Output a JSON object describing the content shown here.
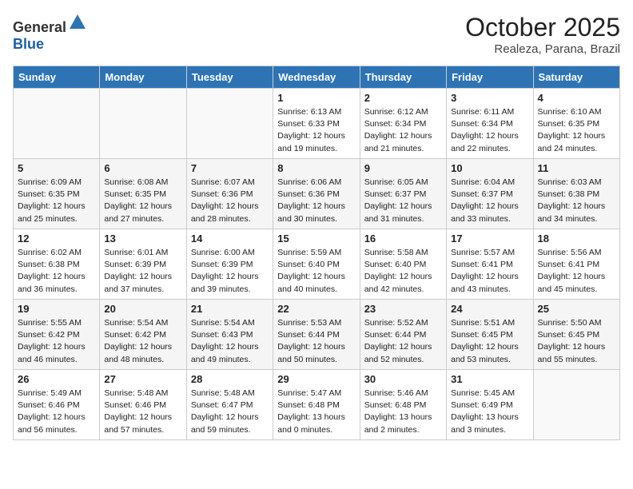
{
  "header": {
    "logo_general": "General",
    "logo_blue": "Blue",
    "month_year": "October 2025",
    "location": "Realeza, Parana, Brazil"
  },
  "weekdays": [
    "Sunday",
    "Monday",
    "Tuesday",
    "Wednesday",
    "Thursday",
    "Friday",
    "Saturday"
  ],
  "weeks": [
    [
      {
        "day": "",
        "info": ""
      },
      {
        "day": "",
        "info": ""
      },
      {
        "day": "",
        "info": ""
      },
      {
        "day": "1",
        "info": "Sunrise: 6:13 AM\nSunset: 6:33 PM\nDaylight: 12 hours\nand 19 minutes."
      },
      {
        "day": "2",
        "info": "Sunrise: 6:12 AM\nSunset: 6:34 PM\nDaylight: 12 hours\nand 21 minutes."
      },
      {
        "day": "3",
        "info": "Sunrise: 6:11 AM\nSunset: 6:34 PM\nDaylight: 12 hours\nand 22 minutes."
      },
      {
        "day": "4",
        "info": "Sunrise: 6:10 AM\nSunset: 6:35 PM\nDaylight: 12 hours\nand 24 minutes."
      }
    ],
    [
      {
        "day": "5",
        "info": "Sunrise: 6:09 AM\nSunset: 6:35 PM\nDaylight: 12 hours\nand 25 minutes."
      },
      {
        "day": "6",
        "info": "Sunrise: 6:08 AM\nSunset: 6:35 PM\nDaylight: 12 hours\nand 27 minutes."
      },
      {
        "day": "7",
        "info": "Sunrise: 6:07 AM\nSunset: 6:36 PM\nDaylight: 12 hours\nand 28 minutes."
      },
      {
        "day": "8",
        "info": "Sunrise: 6:06 AM\nSunset: 6:36 PM\nDaylight: 12 hours\nand 30 minutes."
      },
      {
        "day": "9",
        "info": "Sunrise: 6:05 AM\nSunset: 6:37 PM\nDaylight: 12 hours\nand 31 minutes."
      },
      {
        "day": "10",
        "info": "Sunrise: 6:04 AM\nSunset: 6:37 PM\nDaylight: 12 hours\nand 33 minutes."
      },
      {
        "day": "11",
        "info": "Sunrise: 6:03 AM\nSunset: 6:38 PM\nDaylight: 12 hours\nand 34 minutes."
      }
    ],
    [
      {
        "day": "12",
        "info": "Sunrise: 6:02 AM\nSunset: 6:38 PM\nDaylight: 12 hours\nand 36 minutes."
      },
      {
        "day": "13",
        "info": "Sunrise: 6:01 AM\nSunset: 6:39 PM\nDaylight: 12 hours\nand 37 minutes."
      },
      {
        "day": "14",
        "info": "Sunrise: 6:00 AM\nSunset: 6:39 PM\nDaylight: 12 hours\nand 39 minutes."
      },
      {
        "day": "15",
        "info": "Sunrise: 5:59 AM\nSunset: 6:40 PM\nDaylight: 12 hours\nand 40 minutes."
      },
      {
        "day": "16",
        "info": "Sunrise: 5:58 AM\nSunset: 6:40 PM\nDaylight: 12 hours\nand 42 minutes."
      },
      {
        "day": "17",
        "info": "Sunrise: 5:57 AM\nSunset: 6:41 PM\nDaylight: 12 hours\nand 43 minutes."
      },
      {
        "day": "18",
        "info": "Sunrise: 5:56 AM\nSunset: 6:41 PM\nDaylight: 12 hours\nand 45 minutes."
      }
    ],
    [
      {
        "day": "19",
        "info": "Sunrise: 5:55 AM\nSunset: 6:42 PM\nDaylight: 12 hours\nand 46 minutes."
      },
      {
        "day": "20",
        "info": "Sunrise: 5:54 AM\nSunset: 6:42 PM\nDaylight: 12 hours\nand 48 minutes."
      },
      {
        "day": "21",
        "info": "Sunrise: 5:54 AM\nSunset: 6:43 PM\nDaylight: 12 hours\nand 49 minutes."
      },
      {
        "day": "22",
        "info": "Sunrise: 5:53 AM\nSunset: 6:44 PM\nDaylight: 12 hours\nand 50 minutes."
      },
      {
        "day": "23",
        "info": "Sunrise: 5:52 AM\nSunset: 6:44 PM\nDaylight: 12 hours\nand 52 minutes."
      },
      {
        "day": "24",
        "info": "Sunrise: 5:51 AM\nSunset: 6:45 PM\nDaylight: 12 hours\nand 53 minutes."
      },
      {
        "day": "25",
        "info": "Sunrise: 5:50 AM\nSunset: 6:45 PM\nDaylight: 12 hours\nand 55 minutes."
      }
    ],
    [
      {
        "day": "26",
        "info": "Sunrise: 5:49 AM\nSunset: 6:46 PM\nDaylight: 12 hours\nand 56 minutes."
      },
      {
        "day": "27",
        "info": "Sunrise: 5:48 AM\nSunset: 6:46 PM\nDaylight: 12 hours\nand 57 minutes."
      },
      {
        "day": "28",
        "info": "Sunrise: 5:48 AM\nSunset: 6:47 PM\nDaylight: 12 hours\nand 59 minutes."
      },
      {
        "day": "29",
        "info": "Sunrise: 5:47 AM\nSunset: 6:48 PM\nDaylight: 13 hours\nand 0 minutes."
      },
      {
        "day": "30",
        "info": "Sunrise: 5:46 AM\nSunset: 6:48 PM\nDaylight: 13 hours\nand 2 minutes."
      },
      {
        "day": "31",
        "info": "Sunrise: 5:45 AM\nSunset: 6:49 PM\nDaylight: 13 hours\nand 3 minutes."
      },
      {
        "day": "",
        "info": ""
      }
    ]
  ]
}
